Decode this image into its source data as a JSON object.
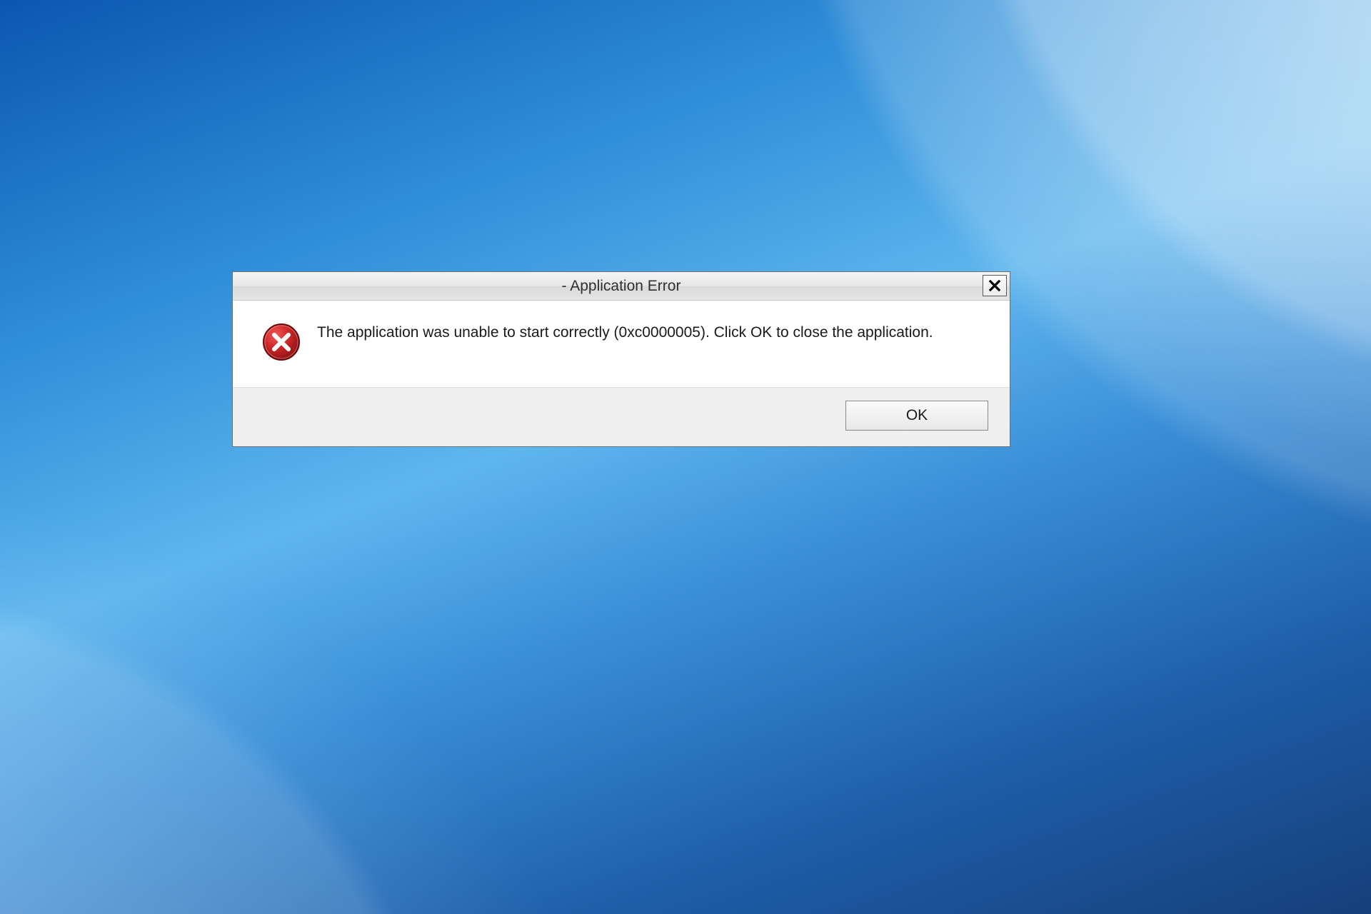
{
  "dialog": {
    "title": "- Application Error",
    "message": "The application was unable to start correctly (0xc0000005). Click OK to close the application.",
    "ok_label": "OK",
    "colors": {
      "error_icon_fill": "#c1272d",
      "error_icon_border": "#7a0d10"
    },
    "icons": {
      "close": "close-icon",
      "error": "error-circle-x-icon"
    }
  }
}
